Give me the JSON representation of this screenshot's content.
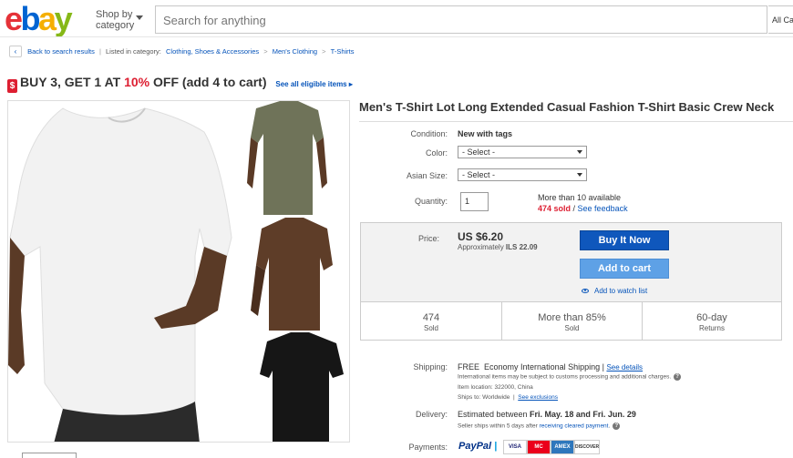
{
  "header": {
    "logo": {
      "e": "e",
      "b": "b",
      "a": "a",
      "y": "y"
    },
    "shop_by_line1": "Shop by",
    "shop_by_line2": "category",
    "search_placeholder": "Search for anything",
    "all_categories": "All Ca"
  },
  "breadcrumb": {
    "back_label": "Back to search results",
    "listed_in": "Listed in category:",
    "items": [
      "Clothing, Shoes & Accessories",
      "Men's Clothing",
      "T-Shirts"
    ]
  },
  "promo": {
    "tag_icon": "$",
    "text_before": "BUY 3, GET 1 AT ",
    "highlight": "10%",
    "text_after": " OFF (add 4 to cart)",
    "see_all": "See all eligible items ▸"
  },
  "product": {
    "title": "Men's T-Shirt Lot Long Extended Casual Fashion T-Shirt Basic Crew Neck",
    "condition_label": "Condition:",
    "condition_value": "New with tags",
    "color_label": "Color:",
    "color_selected": "- Select -",
    "size_label": "Asian Size:",
    "size_selected": "- Select -",
    "quantity_label": "Quantity:",
    "quantity_value": "1",
    "available": "More than 10 available",
    "sold_text": "474 sold",
    "feedback": "See feedback"
  },
  "price": {
    "label": "Price:",
    "value": "US $6.20",
    "approx_prefix": "Approximately ",
    "approx_value": "ILS 22.09",
    "buy_now": "Buy It Now",
    "add_to_cart": "Add to cart",
    "watch": "Add to watch list"
  },
  "stats": [
    {
      "value": "474",
      "label": "Sold"
    },
    {
      "value": "More than 85%",
      "label": "Sold"
    },
    {
      "value": "60-day",
      "label": "Returns"
    }
  ],
  "shipping": {
    "label": "Shipping:",
    "free": "FREE",
    "method": "Economy International Shipping",
    "sep": " | ",
    "see_details": "See details",
    "note1": "International items may be subject to customs processing and additional charges.",
    "location_label": "Item location:",
    "location": "322000, China",
    "ships_to_label": "Ships to:",
    "ships_to": "Worldwide",
    "exclusions": "See exclusions"
  },
  "delivery": {
    "label": "Delivery:",
    "text_prefix": "Estimated between ",
    "range": "Fri. May. 18 and Fri. Jun. 29",
    "note_prefix": "Seller ships within 5 days after ",
    "note_link": "receiving cleared payment",
    "note_suffix": "."
  },
  "payments": {
    "label": "Payments:",
    "paypal_a": "PayPal",
    "paypal_b": "|",
    "cards": [
      "VISA",
      "MC",
      "AMEX",
      "DISCOVER"
    ]
  },
  "colors": {
    "shirt_olive": "#6f7359",
    "shirt_brown": "#5e3d28",
    "shirt_black": "#161616",
    "skin": "#5a3a26",
    "buy_now": "#0f57bc",
    "add_to_cart": "#5ea1e6"
  }
}
